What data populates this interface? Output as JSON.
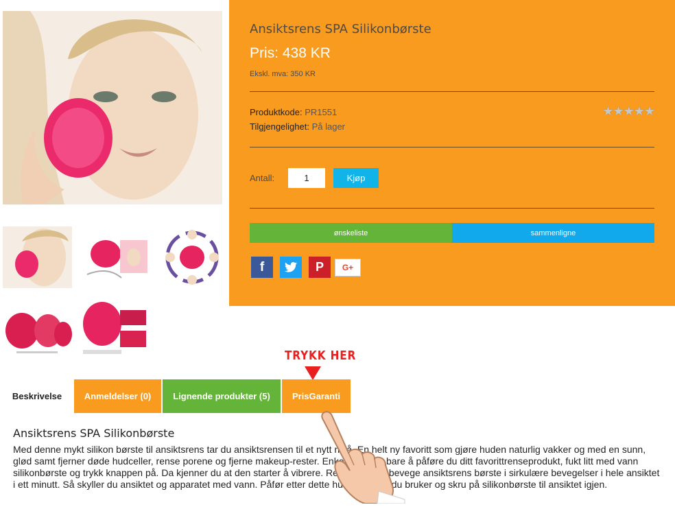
{
  "product": {
    "title": "Ansiktsrens SPA Silikonbørste",
    "price_label": "Pris:",
    "price_value": "438 KR",
    "ex_vat": "Ekskl. mva: 350 KR",
    "code_label": "Produktkode:",
    "code_value": "PR1551",
    "availability_label": "Tilgjengelighet:",
    "availability_value": "På lager",
    "rating_stars": "★★★★★",
    "rating_value": 0,
    "qty_label": "Antall:",
    "qty_value": "1",
    "buy_label": "Kjøp",
    "wishlist_label": "ønskeliste",
    "compare_label": "sammenligne"
  },
  "social": {
    "facebook": "f",
    "twitter": "t",
    "pinterest": "P",
    "googleplus": "G+"
  },
  "callout": {
    "text": "TRYKK HER"
  },
  "tabs": [
    {
      "label": "Beskrivelse"
    },
    {
      "label": "Anmeldelser (0)"
    },
    {
      "label": "Lignende produkter (5)"
    },
    {
      "label": "PrisGaranti"
    }
  ],
  "description": {
    "title": "Ansiktsrens SPA Silikonbørste",
    "text": "Med denne mykt silikon børste til ansiktsrens tar du ansiktsrensen til et nytt nivå. En helt ny favoritt som gjøre huden naturlig vakker og med en sunn, glød samt fjerner døde hudceller, rense porene og fjerne makeup-rester. Enkelt og greit bare å påføre du ditt favorittrenseprodukt, fukt litt med vann silikonbørste og trykk knappen på. Da kjenner du at den starter å vibrere. Rengjør ved å bevege ansiktsrens børste i sirkulære bevegelser i hele ansiktet i ett minutt. Så skyller du ansiktet og apparatet med vann. Påfør etter dette hudprodukter du bruker og skru på silikonbørste til ansiktet igjen."
  },
  "colors": {
    "accent_orange": "#f99b1f",
    "green": "#64b43a",
    "blue": "#11a8ec",
    "callout_red": "#e8201f"
  }
}
